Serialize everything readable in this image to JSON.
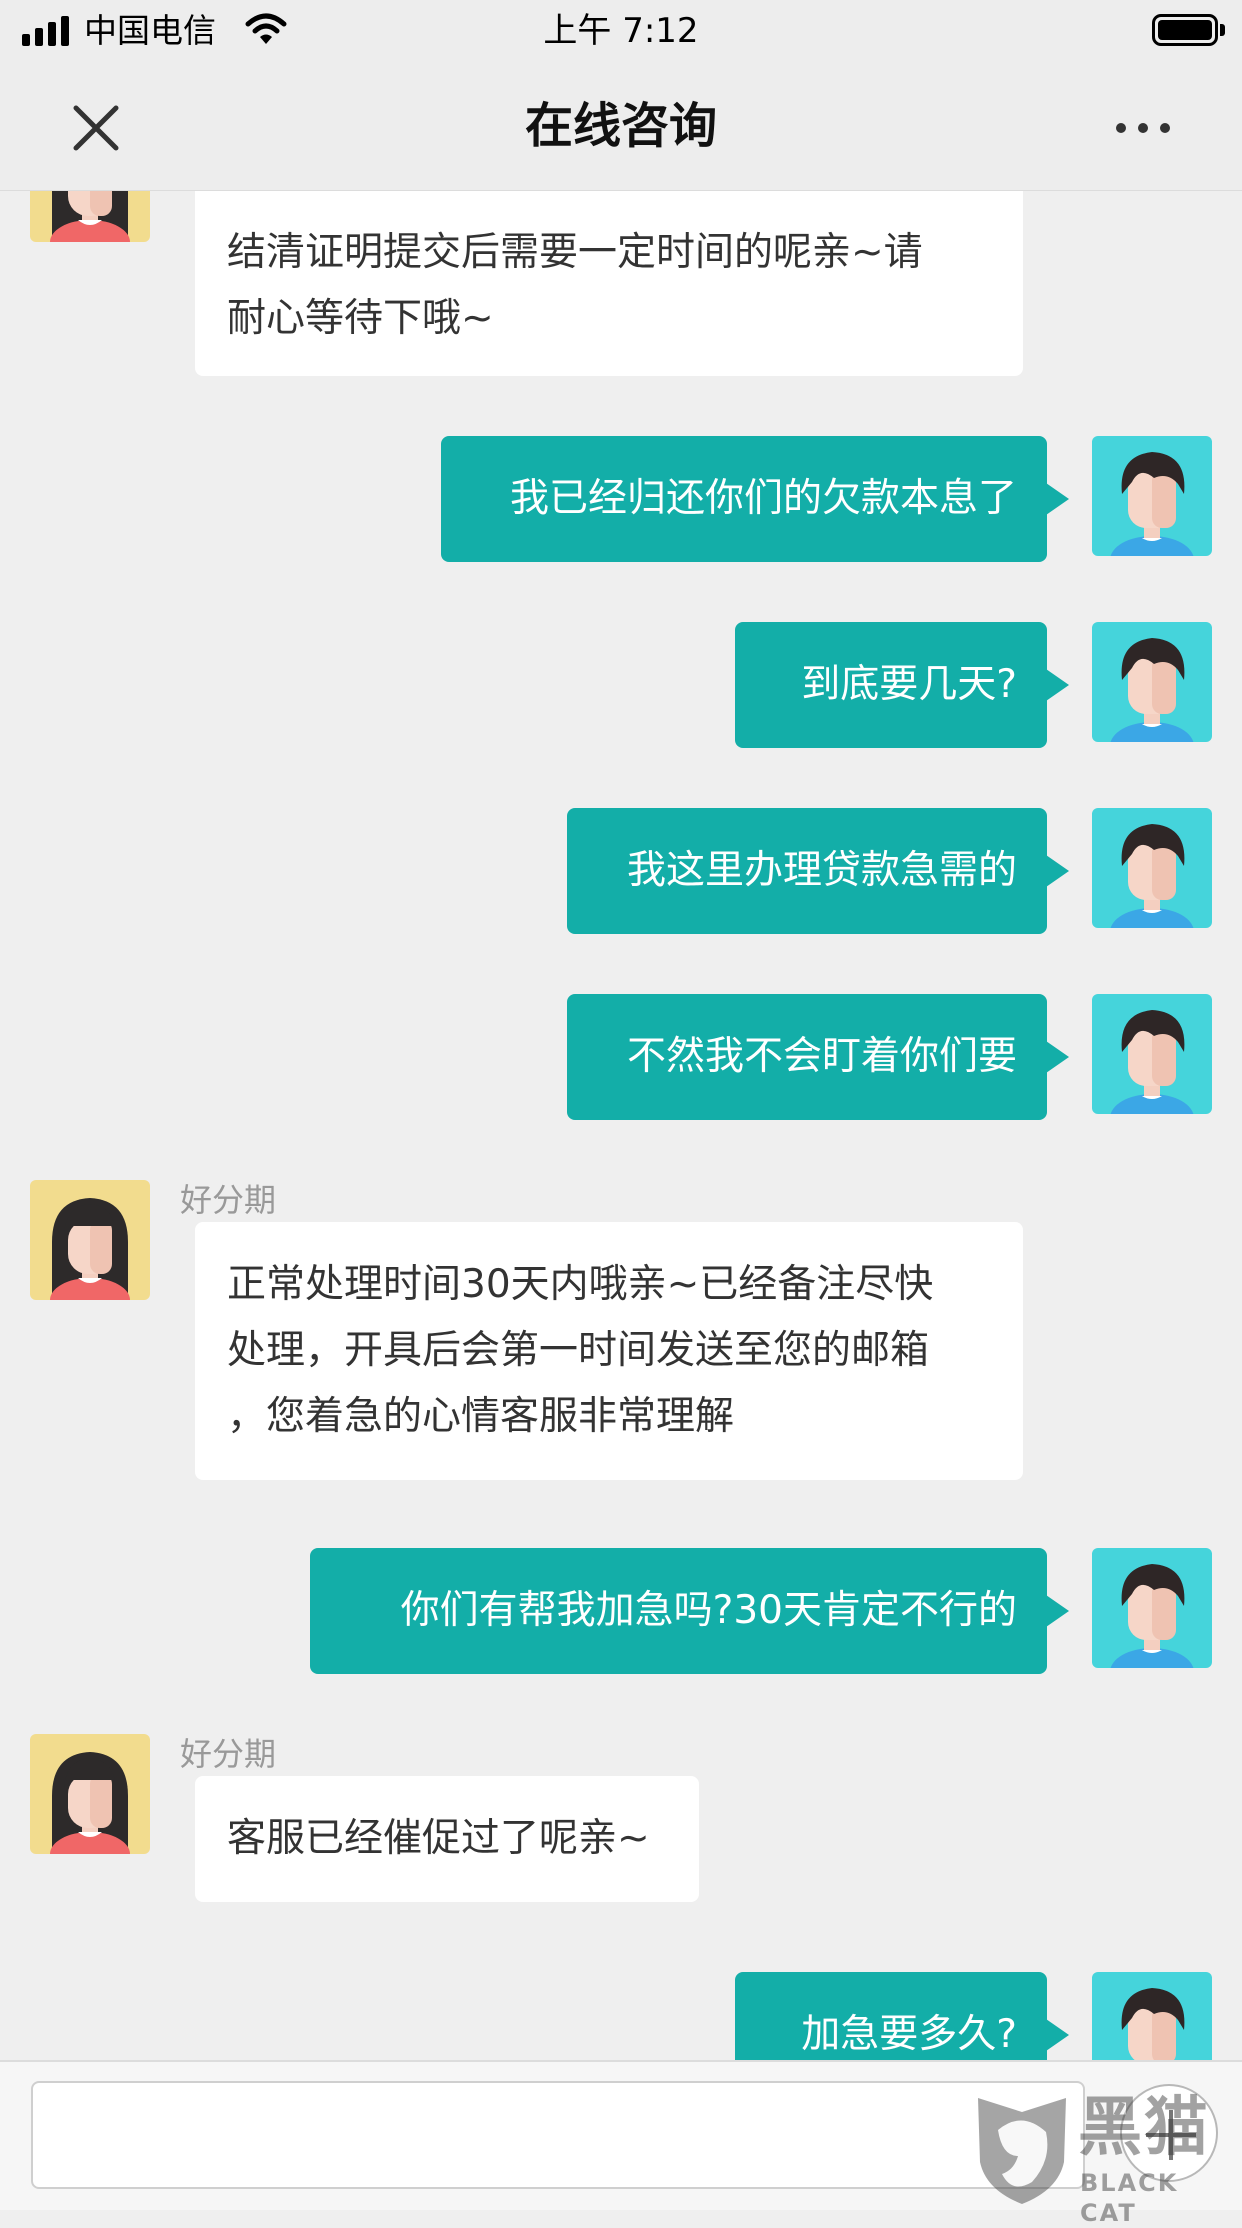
{
  "status_bar": {
    "carrier": "中国电信",
    "time": "上午 7:12"
  },
  "nav": {
    "title": "在线咨询"
  },
  "colors": {
    "bubble_outgoing": "#13aea8",
    "bubble_incoming": "#ffffff",
    "background": "#efefef"
  },
  "messages": [
    {
      "from": "agent",
      "sender": "",
      "lines": [
        "结清证明提交后需要一定时间的呢亲~请",
        "耐心等待下哦~"
      ]
    },
    {
      "from": "user",
      "lines": [
        "我已经归还你们的欠款本息了"
      ]
    },
    {
      "from": "user",
      "lines": [
        "到底要几天?"
      ]
    },
    {
      "from": "user",
      "lines": [
        "我这里办理贷款急需的"
      ]
    },
    {
      "from": "user",
      "lines": [
        "不然我不会盯着你们要"
      ]
    },
    {
      "from": "agent",
      "sender": "好分期",
      "lines": [
        "正常处理时间30天内哦亲~已经备注尽快",
        "处理，开具后会第一时间发送至您的邮箱",
        "，您着急的心情客服非常理解"
      ]
    },
    {
      "from": "user",
      "lines": [
        "你们有帮我加急吗?30天肯定不行的"
      ]
    },
    {
      "from": "agent",
      "sender": "好分期",
      "lines": [
        "客服已经催促过了呢亲~"
      ]
    },
    {
      "from": "user",
      "lines": [
        "加急要多久?"
      ]
    }
  ],
  "input": {
    "placeholder": ""
  },
  "watermark": {
    "text": "黑猫",
    "subtext": "BLACK CAT"
  }
}
